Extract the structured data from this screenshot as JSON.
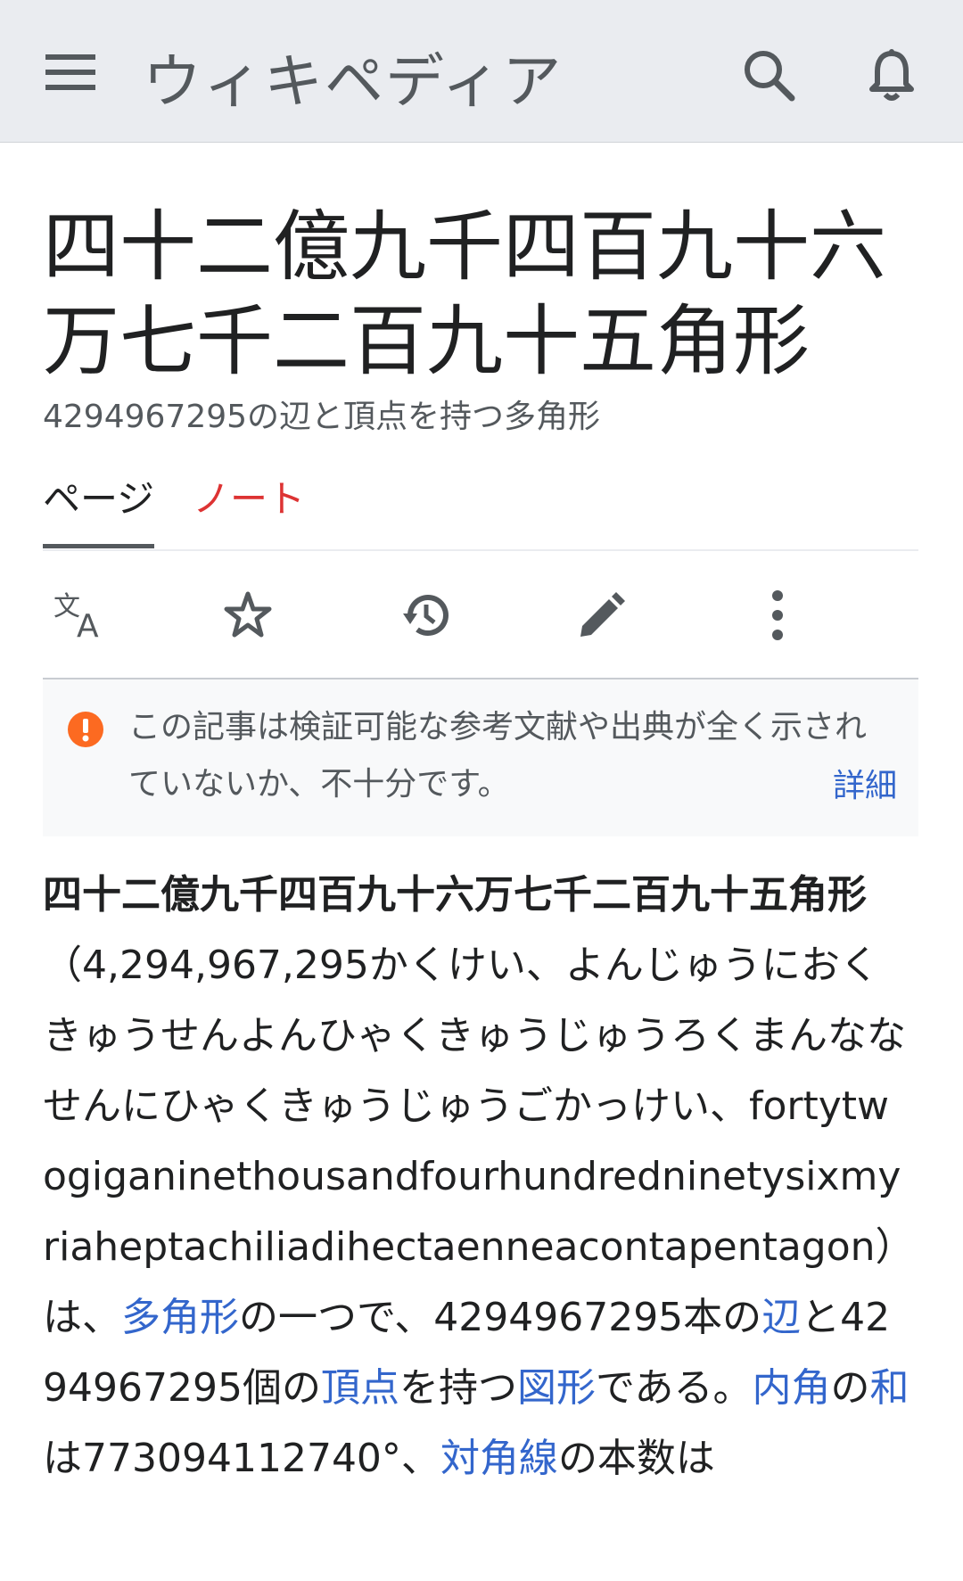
{
  "header": {
    "wordmark": "ウィキペディア",
    "icons": [
      "menu-icon",
      "search-icon",
      "bell-icon"
    ]
  },
  "page": {
    "title": "四十二億九千四百九十六万七千二百九十五角形",
    "subtitle": "4294967295の辺と頂点を持つ多角形"
  },
  "tabs": {
    "page": "ページ",
    "talk": "ノート"
  },
  "actions": [
    "language-icon",
    "star-icon",
    "history-icon",
    "edit-icon",
    "more-icon"
  ],
  "notice": {
    "text": "この記事は検証可能な参考文献や出典が全く示されていないか、不十分です。",
    "more": "詳細"
  },
  "article": {
    "bold_term": "四十二億九千四百九十六万七千二百九十五角形",
    "paren": "（4,294,967,295かくけい、よんじゅうにおくきゅうせんよんひゃくきゅうじゅうろくまんななせんにひゃくきゅうじゅうごかっけい、fortytwogiganinethousandfourhundredninetysixmyriaheptachiliadihectaenneacontapentagon）は、",
    "link_polygon": "多角形",
    "t1": "の一つで、4294967295本の",
    "link_edge": "辺",
    "t2": "と4294967295個の",
    "link_vertex": "頂点",
    "t3": "を持つ",
    "link_figure": "図形",
    "t4": "である。",
    "link_interior": "内角",
    "t5": "の",
    "link_sum": "和",
    "t6": "は773094112740°、",
    "link_diagonal": "対角線",
    "t7": "の本数は"
  },
  "colors": {
    "link": "#3366cc",
    "talk": "#dd3333",
    "warning": "#fc6a21"
  }
}
